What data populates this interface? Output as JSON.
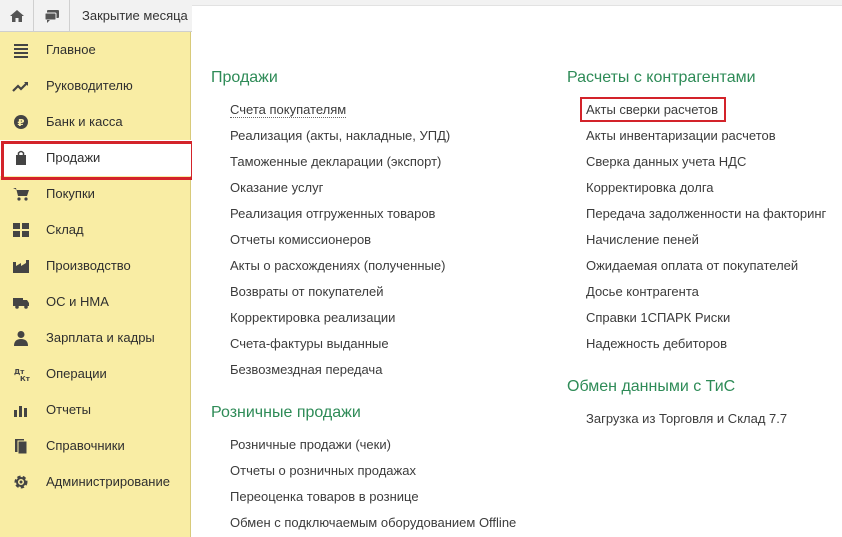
{
  "topbar": {
    "tab_title": "Закрытие месяца"
  },
  "sidebar": {
    "items": [
      {
        "label": "Главное"
      },
      {
        "label": "Руководителю"
      },
      {
        "label": "Банк и касса"
      },
      {
        "label": "Продажи"
      },
      {
        "label": "Покупки"
      },
      {
        "label": "Склад"
      },
      {
        "label": "Производство"
      },
      {
        "label": "ОС и НМА"
      },
      {
        "label": "Зарплата и кадры"
      },
      {
        "label": "Операции"
      },
      {
        "label": "Отчеты"
      },
      {
        "label": "Справочники"
      },
      {
        "label": "Администрирование"
      }
    ],
    "active_index": 3
  },
  "sections": {
    "sales": {
      "title": "Продажи",
      "links": [
        "Счета покупателям",
        "Реализация (акты, накладные, УПД)",
        "Таможенные декларации (экспорт)",
        "Оказание услуг",
        "Реализация отгруженных товаров",
        "Отчеты комиссионеров",
        "Акты о расхождениях (полученные)",
        "Возвраты от покупателей",
        "Корректировка реализации",
        "Счета-фактуры выданные",
        "Безвозмездная передача"
      ]
    },
    "retail": {
      "title": "Розничные продажи",
      "links": [
        "Розничные продажи (чеки)",
        "Отчеты о розничных продажах",
        "Переоценка товаров в рознице",
        "Обмен с подключаемым оборудованием Offline"
      ]
    },
    "settlements": {
      "title": "Расчеты с контрагентами",
      "links": [
        "Акты сверки расчетов",
        "Акты инвентаризации расчетов",
        "Сверка данных учета НДС",
        "Корректировка долга",
        "Передача задолженности на факторинг",
        "Начисление пеней",
        "Ожидаемая оплата от покупателей",
        "Досье контрагента",
        "Справки 1СПАРК Риски",
        "Надежность дебиторов"
      ]
    },
    "exchange": {
      "title": "Обмен данными с ТиС",
      "links": [
        "Загрузка из Торговля и Склад 7.7"
      ]
    }
  },
  "colors": {
    "sidebar_bg": "#f9eda4",
    "section_title": "#2e8b57",
    "highlight": "#d3232a"
  }
}
